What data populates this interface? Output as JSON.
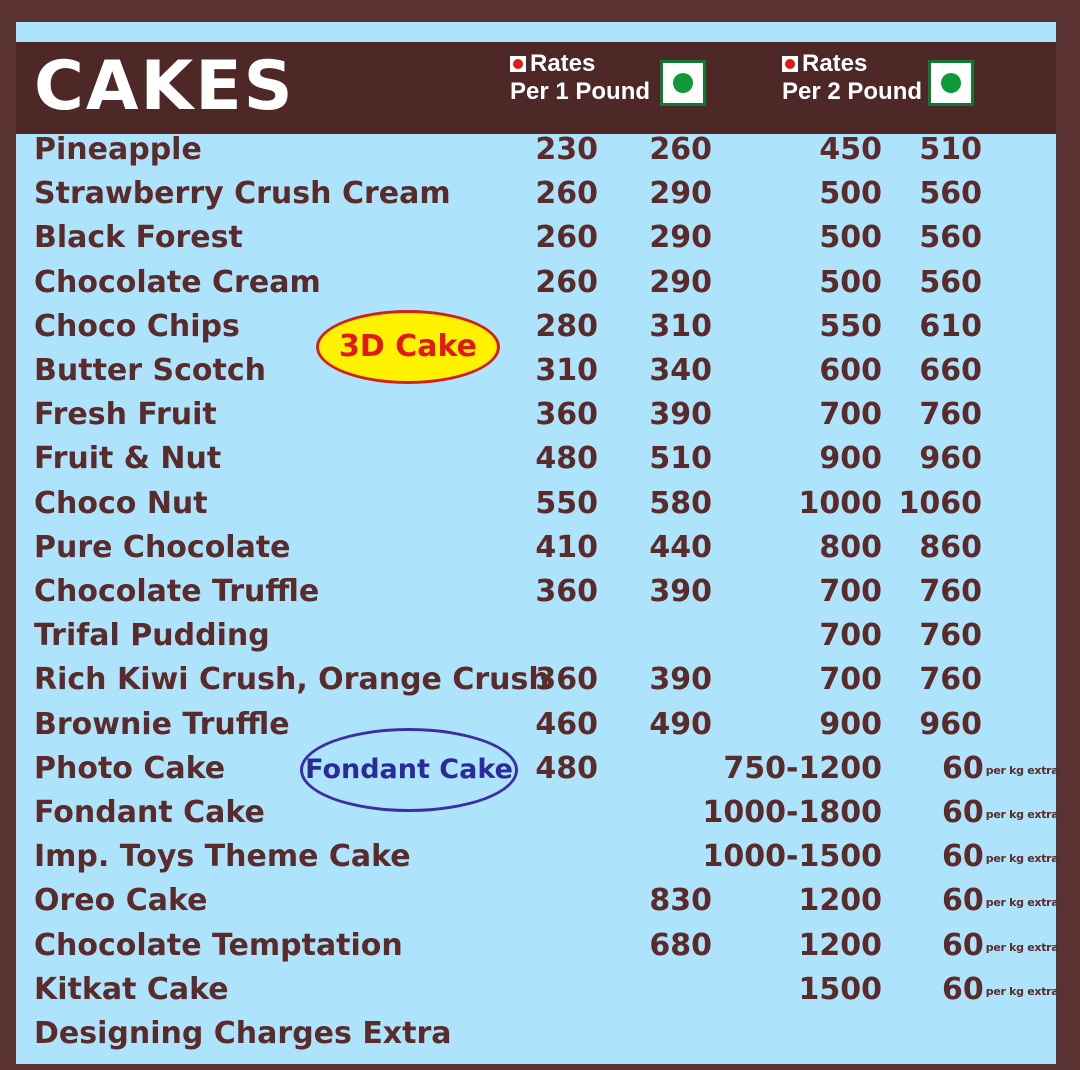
{
  "title": "CAKES",
  "header": {
    "rates_label": "Rates",
    "per1": "Per 1 Pound",
    "per2": "Per 2 Pound"
  },
  "badges": {
    "three_d": "3D Cake",
    "fondant": "Fondant Cake"
  },
  "per_kg_extra": "per kg extra",
  "colors": {
    "background": "#5a3232",
    "panel": "#aee4fb",
    "header": "#4e2727",
    "text": "#5b2a2a",
    "veg_green": "#0f9a3a",
    "nonveg_red": "#e01818"
  },
  "items": [
    {
      "name": "Pineapple",
      "p1": "230",
      "p2": "260",
      "p3": "450",
      "p4": "510"
    },
    {
      "name": "Strawberry Crush Cream",
      "p1": "260",
      "p2": "290",
      "p3": "500",
      "p4": "560"
    },
    {
      "name": "Black Forest",
      "p1": "260",
      "p2": "290",
      "p3": "500",
      "p4": "560"
    },
    {
      "name": "Chocolate Cream",
      "p1": "260",
      "p2": "290",
      "p3": "500",
      "p4": "560"
    },
    {
      "name": "Choco Chips",
      "p1": "280",
      "p2": "310",
      "p3": "550",
      "p4": "610"
    },
    {
      "name": "Butter Scotch",
      "p1": "310",
      "p2": "340",
      "p3": "600",
      "p4": "660"
    },
    {
      "name": "Fresh Fruit",
      "p1": "360",
      "p2": "390",
      "p3": "700",
      "p4": "760"
    },
    {
      "name": "Fruit & Nut",
      "p1": "480",
      "p2": "510",
      "p3": "900",
      "p4": "960"
    },
    {
      "name": "Choco Nut",
      "p1": "550",
      "p2": "580",
      "p3": "1000",
      "p4": "1060"
    },
    {
      "name": "Pure Chocolate",
      "p1": "410",
      "p2": "440",
      "p3": "800",
      "p4": "860"
    },
    {
      "name": "Chocolate Truffle",
      "p1": "360",
      "p2": "390",
      "p3": "700",
      "p4": "760"
    },
    {
      "name": "Trifal Pudding",
      "p1": "",
      "p2": "",
      "p3": "700",
      "p4": "760"
    },
    {
      "name": "Rich Kiwi Crush, Orange Crush",
      "p1": "360",
      "p2": "390",
      "p3": "700",
      "p4": "760"
    },
    {
      "name": "Brownie Truffle",
      "p1": "460",
      "p2": "490",
      "p3": "900",
      "p4": "960"
    },
    {
      "name": "Photo Cake",
      "p1": "480",
      "p2": "",
      "p3": "750-1200",
      "p4": "60",
      "extra": true
    },
    {
      "name": "Fondant Cake",
      "p1": "",
      "p2": "",
      "p3": "1000-1800",
      "p4": "60",
      "extra": true
    },
    {
      "name": "Imp. Toys Theme Cake",
      "p1": "",
      "p2": "",
      "p3": "1000-1500",
      "p4": "60",
      "extra": true
    },
    {
      "name": "Oreo Cake",
      "p1": "",
      "p2": "830",
      "p3": "1200",
      "p4": "60",
      "extra": true
    },
    {
      "name": "Chocolate Temptation",
      "p1": "",
      "p2": "680",
      "p3": "1200",
      "p4": "60",
      "extra": true
    },
    {
      "name": "Kitkat Cake",
      "p1": "",
      "p2": "",
      "p3": "1500",
      "p4": "60",
      "extra": true
    },
    {
      "name": "Designing Charges Extra",
      "p1": "",
      "p2": "",
      "p3": "",
      "p4": ""
    }
  ]
}
